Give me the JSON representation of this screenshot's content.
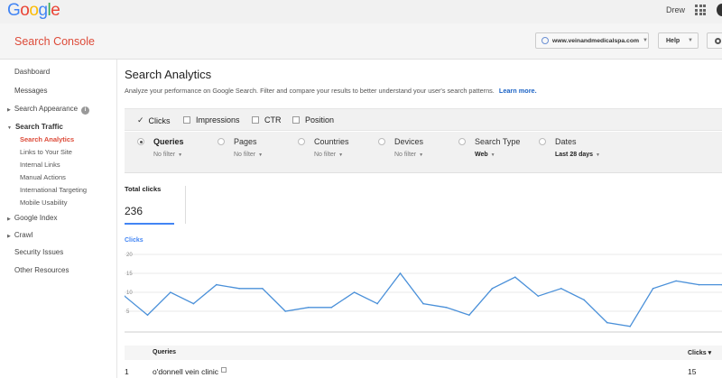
{
  "top": {
    "logo_letters": [
      {
        "ch": "G",
        "color": "#4285f4"
      },
      {
        "ch": "o",
        "color": "#ea4335"
      },
      {
        "ch": "o",
        "color": "#fbbc05"
      },
      {
        "ch": "g",
        "color": "#4285f4"
      },
      {
        "ch": "l",
        "color": "#34a853"
      },
      {
        "ch": "e",
        "color": "#ea4335"
      }
    ],
    "user_name": "Drew",
    "apps_icon": "apps-grid-icon"
  },
  "header": {
    "app_title": "Search Console",
    "site": "www.veinandmedicalspa.com",
    "help_label": "Help",
    "settings_icon": "gear-icon"
  },
  "sidebar": {
    "items": [
      {
        "label": "Dashboard"
      },
      {
        "label": "Messages"
      },
      {
        "label": "Search Appearance"
      },
      {
        "label": "Search Traffic"
      },
      {
        "label": "Search Analytics"
      },
      {
        "label": "Links to Your Site"
      },
      {
        "label": "Internal Links"
      },
      {
        "label": "Manual Actions"
      },
      {
        "label": "International Targeting"
      },
      {
        "label": "Mobile Usability"
      },
      {
        "label": "Google Index"
      },
      {
        "label": "Crawl"
      },
      {
        "label": "Security Issues"
      },
      {
        "label": "Other Resources"
      }
    ]
  },
  "main": {
    "title": "Search Analytics",
    "description": "Analyze your performance on Google Search. Filter and compare your results to better understand your user's search patterns.",
    "learn_more": "Learn more.",
    "metrics": [
      {
        "label": "Clicks",
        "checked": true
      },
      {
        "label": "Impressions",
        "checked": false
      },
      {
        "label": "CTR",
        "checked": false
      },
      {
        "label": "Position",
        "checked": false
      }
    ],
    "groups": [
      {
        "label": "Queries",
        "filter": "No filter",
        "selected": true
      },
      {
        "label": "Pages",
        "filter": "No filter",
        "selected": false
      },
      {
        "label": "Countries",
        "filter": "No filter",
        "selected": false
      },
      {
        "label": "Devices",
        "filter": "No filter",
        "selected": false
      },
      {
        "label": "Search Type",
        "filter": "Web",
        "selected": false
      },
      {
        "label": "Dates",
        "filter": "Last 28 days",
        "selected": false
      }
    ],
    "total_label": "Total clicks",
    "total_value": "236",
    "chart_label": "Clicks",
    "table": {
      "col_query": "Queries",
      "col_clicks": "Clicks ▾",
      "rows": [
        {
          "rank": "1",
          "query": "o'donnell vein clinic",
          "clicks": "15"
        }
      ]
    }
  },
  "chart_data": {
    "type": "line",
    "title": "",
    "xlabel": "",
    "ylabel": "Clicks",
    "ylim": [
      0,
      20
    ],
    "yticks": [
      "20",
      "15",
      "10",
      "5"
    ],
    "color": "#4a90d9",
    "grid": true,
    "series": [
      {
        "values": [
          9,
          4,
          10,
          7,
          12,
          11,
          11,
          5,
          6,
          6,
          10,
          7,
          15,
          7,
          6,
          4,
          11,
          14,
          9,
          11,
          8,
          2,
          1,
          11,
          13,
          12,
          12
        ]
      }
    ]
  }
}
